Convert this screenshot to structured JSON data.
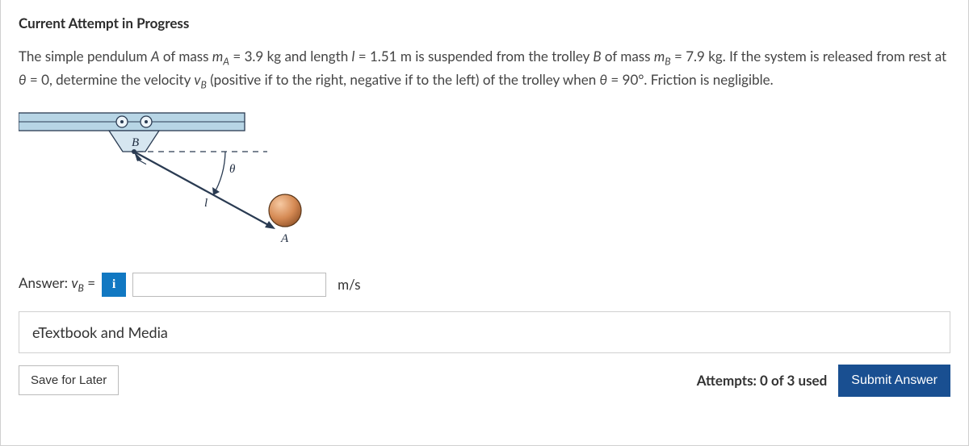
{
  "heading": "Current Attempt in Progress",
  "prompt": {
    "part1": "The simple pendulum ",
    "A": "A",
    "part2": " of mass ",
    "mA_sym": "m",
    "mA_sub": "A",
    "part3": " = 3.9 kg and length ",
    "l_sym": "l",
    "part4": " = 1.51 m is suspended from the trolley ",
    "B": "B",
    "part5": " of mass ",
    "mB_sym": "m",
    "mB_sub": "B",
    "part6": " = 7.9 kg. If the system is released from rest at ",
    "theta1": "θ",
    "part7": " = 0, determine the velocity ",
    "vB_sym": "v",
    "vB_sub": "B",
    "part8": " (positive if to the right, negative if to the left) of the trolley when ",
    "theta2": "θ",
    "part9": " = 90°. Friction is negligible."
  },
  "diagram": {
    "B": "B",
    "l": "l",
    "theta": "θ",
    "A": "A"
  },
  "answer": {
    "label_pre": "Answer: ",
    "v": "v",
    "sub": "B",
    "eq": " = ",
    "info": "i",
    "value": "",
    "unit": "m/s"
  },
  "etextbook": "eTextbook and Media",
  "save": "Save for Later",
  "attempts": "Attempts: 0 of 3 used",
  "submit": "Submit Answer"
}
